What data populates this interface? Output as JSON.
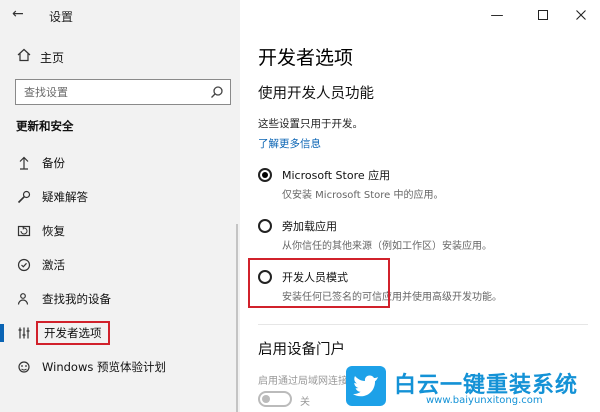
{
  "window": {
    "title": "设置",
    "back_icon": "arrow-left-icon",
    "controls": [
      "minimize-icon",
      "maximize-icon",
      "close-icon"
    ]
  },
  "sidebar": {
    "home_label": "主页",
    "search_placeholder": "查找设置",
    "section_title": "更新和安全",
    "items": [
      {
        "label": "备份",
        "icon": "backup-arrow-icon"
      },
      {
        "label": "疑难解答",
        "icon": "wrench-icon"
      },
      {
        "label": "恢复",
        "icon": "recovery-icon"
      },
      {
        "label": "激活",
        "icon": "check-circle-icon"
      },
      {
        "label": "查找我的设备",
        "icon": "person-location-icon"
      },
      {
        "label": "开发者选项",
        "icon": "developer-tools-icon",
        "active": true
      },
      {
        "label": "Windows 预览体验计划",
        "icon": "insider-icon"
      }
    ]
  },
  "main": {
    "page_title": "开发者选项",
    "section_title": "使用开发人员功能",
    "description": "这些设置只用于开发。",
    "learn_more": "了解更多信息",
    "options": [
      {
        "label": "Microsoft Store 应用",
        "sub": "仅安装 Microsoft Store 中的应用。",
        "checked": true
      },
      {
        "label": "旁加载应用",
        "sub": "从你信任的其他来源（例如工作区）安装应用。",
        "checked": false
      },
      {
        "label": "开发人员模式",
        "sub": "安装任何已签名的可信应用并使用高级开发功能。",
        "checked": false
      }
    ],
    "portal_title": "启用设备门户",
    "portal_desc": "启用通过局域网连接",
    "toggle_label": "关"
  },
  "watermark": {
    "brand": "白云一键重装系统",
    "url": "www.baiyunxitong.com"
  },
  "colors": {
    "accent": "#0a64b4",
    "highlight": "#d1212b",
    "sidebar_bg": "#f2f2f2"
  }
}
